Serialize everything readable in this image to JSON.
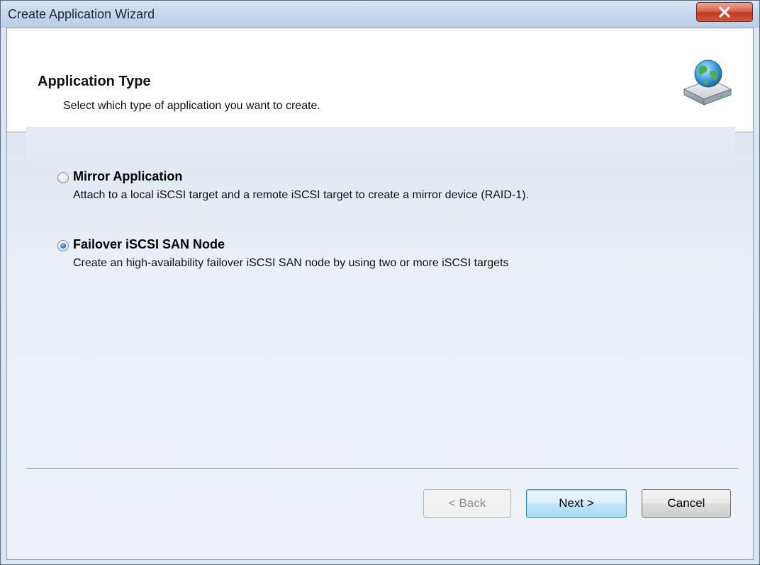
{
  "window": {
    "title": "Create Application Wizard",
    "close_label": "x"
  },
  "header": {
    "title": "Application Type",
    "subtitle": "Select which type of application you want to create.",
    "icon": "globe-drive-icon"
  },
  "options": [
    {
      "label": "Mirror Application",
      "description": "Attach to a local iSCSI target and a remote iSCSI target to create a mirror device (RAID-1).",
      "selected": false
    },
    {
      "label": "Failover iSCSI SAN Node",
      "description": "Create an high-availability failover iSCSI SAN node by using two or more iSCSI targets",
      "selected": true
    }
  ],
  "buttons": {
    "back": "< Back",
    "next": "Next >",
    "cancel": "Cancel"
  },
  "colors": {
    "close_button": "#c2371f",
    "radio_selected": "#2b6fc9",
    "default_button_border": "#3c7fb1"
  }
}
